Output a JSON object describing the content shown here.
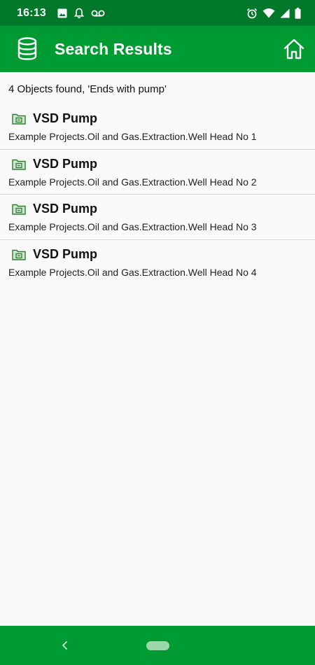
{
  "status_bar": {
    "time": "16:13",
    "left_icons": [
      "image-icon",
      "bell-icon",
      "voicemail-icon"
    ],
    "right_icons": [
      "alarm-icon",
      "wifi-icon",
      "signal-icon",
      "battery-icon"
    ]
  },
  "app_bar": {
    "title": "Search Results",
    "icon": "database-icon",
    "home_icon": "home-icon"
  },
  "search": {
    "summary": "4 Objects found, 'Ends with pump'"
  },
  "results": [
    {
      "title": "VSD Pump",
      "path": "Example Projects.Oil and Gas.Extraction.Well Head No 1",
      "icon": "folder-object-icon"
    },
    {
      "title": "VSD Pump",
      "path": "Example Projects.Oil and Gas.Extraction.Well Head No 2",
      "icon": "folder-object-icon"
    },
    {
      "title": "VSD Pump",
      "path": "Example Projects.Oil and Gas.Extraction.Well Head No 3",
      "icon": "folder-object-icon"
    },
    {
      "title": "VSD Pump",
      "path": "Example Projects.Oil and Gas.Extraction.Well Head No 4",
      "icon": "folder-object-icon"
    }
  ],
  "nav_bar": {
    "back_icon": "back-chevron-icon",
    "home_pill": "home-pill"
  },
  "colors": {
    "status_bar": "#00782a",
    "app_bar": "#009a32",
    "background": "#fafafa",
    "divider": "#d6d6d6",
    "item_icon": "#2e7d32"
  }
}
